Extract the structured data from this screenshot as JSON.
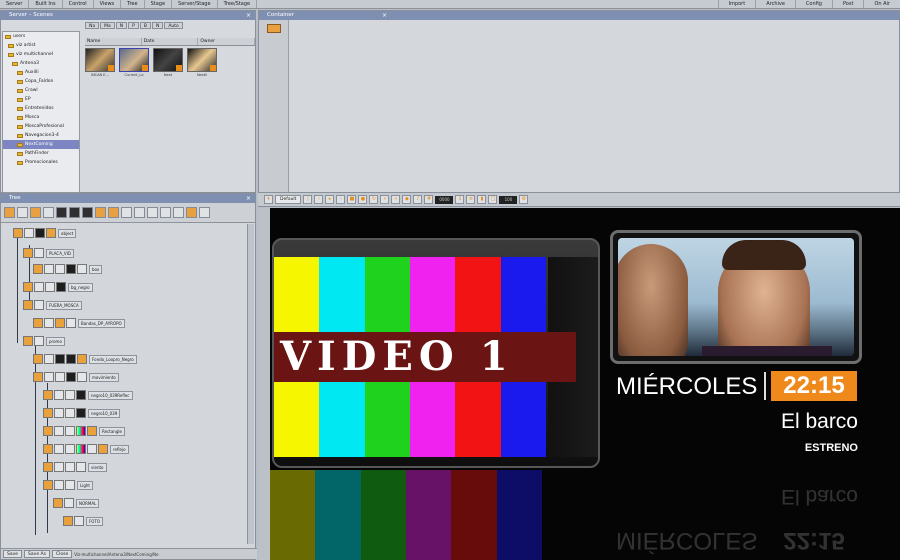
{
  "menubar": {
    "items": [
      "Server",
      "Built Ins",
      "Control",
      "Views",
      "Tree",
      "Stage",
      "Server/Stage",
      "Tree/Stage"
    ],
    "right_items": [
      "Import",
      "Archive",
      "Config",
      "Post",
      "On Air"
    ]
  },
  "scenes_panel": {
    "title": "Server – Scenes",
    "tabs": [
      "Na",
      "Ma",
      "N",
      "P",
      "B",
      "N",
      "Auto"
    ],
    "columns": [
      "Name",
      "Date",
      "Owner"
    ],
    "tree": [
      {
        "label": "users"
      },
      {
        "label": "viz artist"
      },
      {
        "label": "viz multichannel"
      },
      {
        "label": "Antena3"
      },
      {
        "label": "Auxilli"
      },
      {
        "label": "Copa_Faldon"
      },
      {
        "label": "Crawl"
      },
      {
        "label": "EP"
      },
      {
        "label": "Entretenidos"
      },
      {
        "label": "Mosca"
      },
      {
        "label": "MoscaProfesional"
      },
      {
        "label": "Navegacion3-4"
      },
      {
        "label": "NextComing"
      },
      {
        "label": "PathFinder"
      },
      {
        "label": "Promocionales"
      }
    ],
    "thumbnails": [
      {
        "label": "INCAN E…"
      },
      {
        "label": "Current_Lo"
      },
      {
        "label": "Next"
      },
      {
        "label": "Nextli"
      }
    ]
  },
  "container_panel": {
    "title": "Container"
  },
  "tree_panel": {
    "title": "Tree",
    "nodes": [
      {
        "label": "object"
      },
      {
        "label": "PLACA_VID"
      },
      {
        "label": "box"
      },
      {
        "label": "bg_negro"
      },
      {
        "label": "FUERA_MOSCA"
      },
      {
        "label": "Bandas_DP_AYROPO"
      },
      {
        "label": "promo"
      },
      {
        "label": "Fondo_Loopro_Negro"
      },
      {
        "label": "movimiento"
      },
      {
        "label": "negro10_039Reflec"
      },
      {
        "label": "negro10_039"
      },
      {
        "label": "Rectangle"
      },
      {
        "label": "reflejo"
      },
      {
        "label": "viento"
      },
      {
        "label": "Light"
      },
      {
        "label": "NORMAL"
      },
      {
        "label": "FOTO"
      }
    ],
    "bottom": {
      "buttons": [
        "Save",
        "Save As",
        "Close"
      ],
      "path": "Viz-multichannel/Antena3/NextComing/Ne"
    }
  },
  "preview_toolbar": {
    "default_label": "Default",
    "frame_field": "0000",
    "value_field": "100"
  },
  "preview": {
    "video_label": "VIDEO 1",
    "bar_colors": [
      "#f6f600",
      "#00e9f2",
      "#1ed21e",
      "#ef22ef",
      "#f21414",
      "#1a1aee"
    ],
    "day": "MIÉRCOLES",
    "time": "22:15",
    "program": "El barco",
    "tag": "ESTRENO",
    "accent": "#f0891c"
  }
}
